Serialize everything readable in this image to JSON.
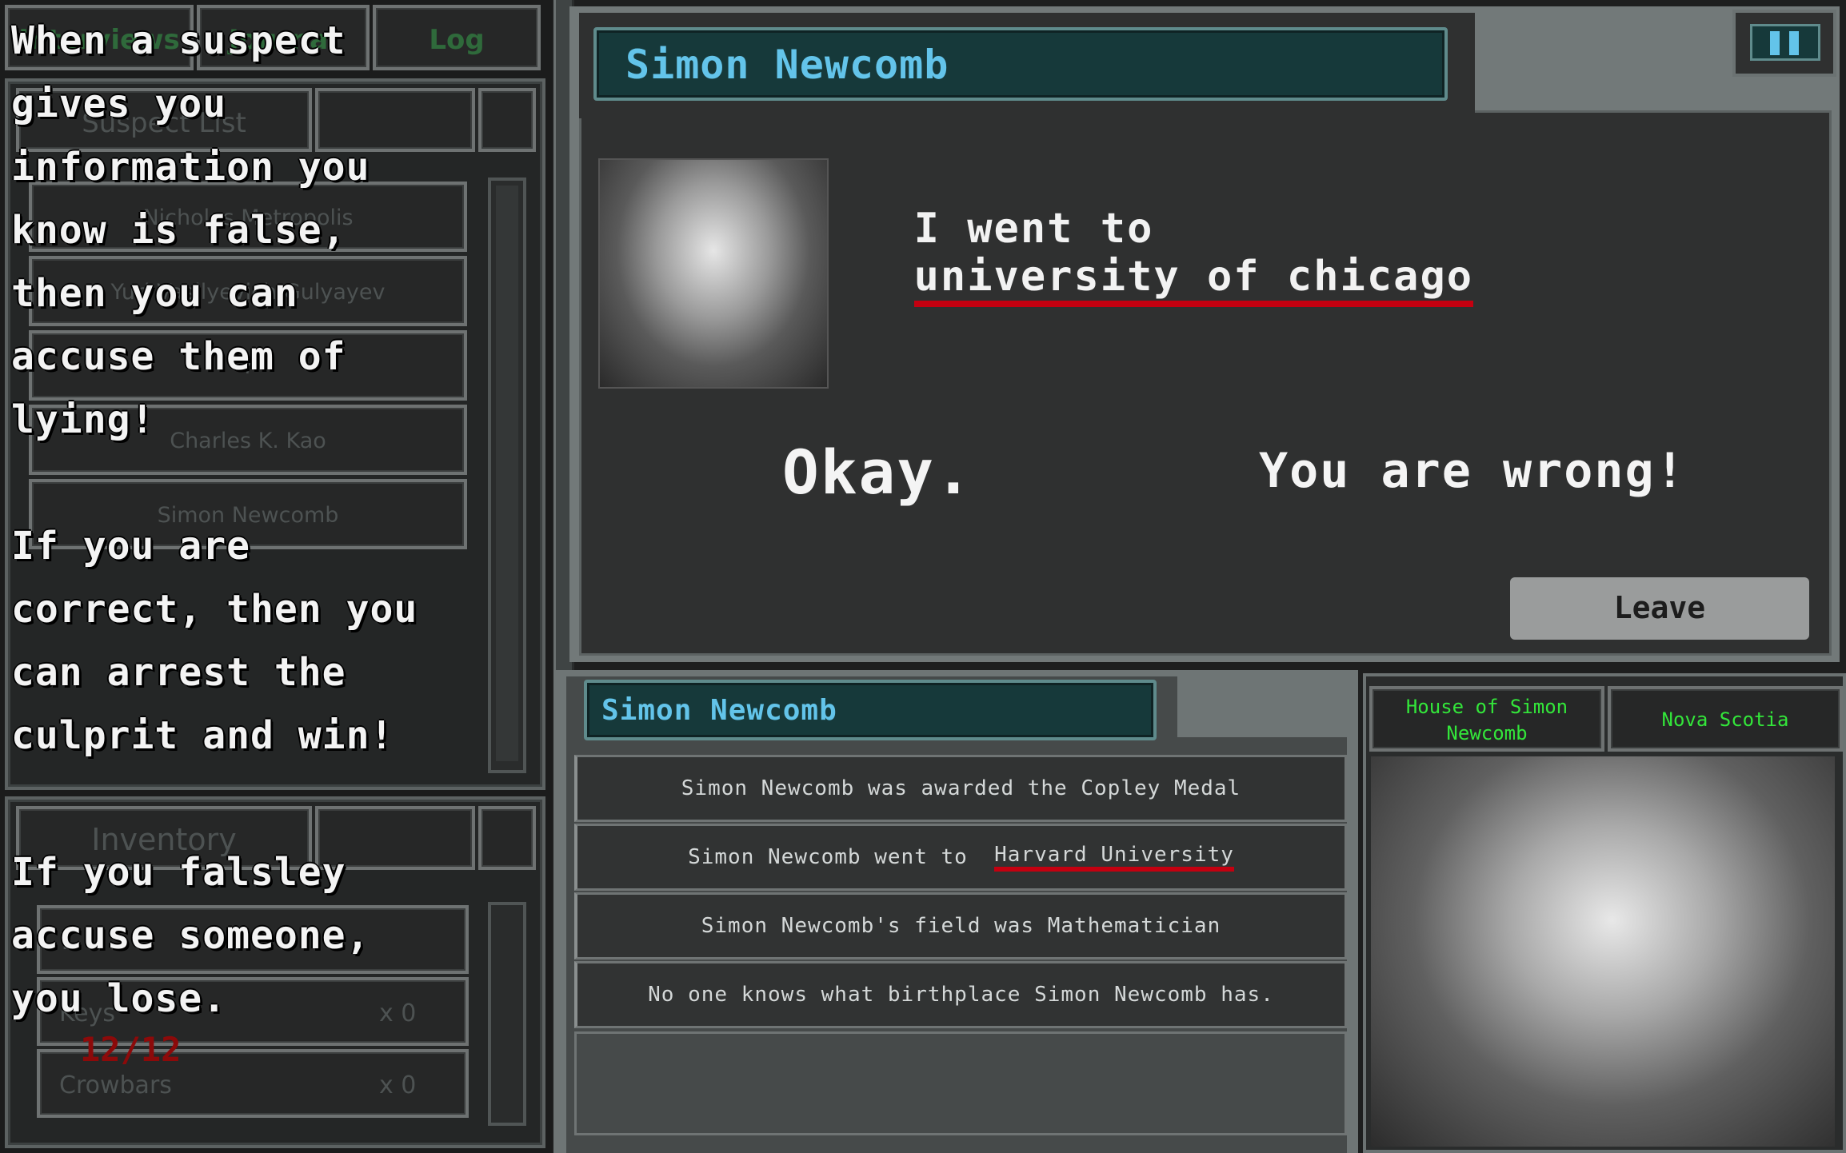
{
  "left_panel": {
    "tabs": [
      "Interviews",
      "Journal",
      "Log"
    ],
    "suspect_list_title": "Suspect List",
    "suspects": [
      "Nicholas Metropolis",
      "Yuri Vasilyevich Gulyayev",
      "?",
      "Charles K. Kao",
      "Simon Newcomb"
    ],
    "inventory_title": "Inventory",
    "inventory_items": [
      {
        "name": "?",
        "count": ""
      },
      {
        "name": "Keys",
        "count": "x 0"
      },
      {
        "name": "Crowbars",
        "count": "x 0"
      }
    ],
    "counter": "12/12"
  },
  "tutorial": {
    "para1": [
      "When a suspect",
      "gives you",
      "information you",
      "know is false,",
      "then you can",
      "accuse them of",
      "lying!"
    ],
    "para2": [
      "If you are",
      "correct, then you",
      "can arrest the",
      "culprit and win!"
    ],
    "para3": [
      "If you falsley",
      "accuse someone,",
      "you lose."
    ]
  },
  "dialogue": {
    "speaker": "Simon Newcomb",
    "statement_prefix": "I went to",
    "statement_highlight": "university of chicago",
    "option_ok": "Okay.",
    "option_wrong": "You are wrong!",
    "leave_label": "Leave",
    "pause_icon": "pause-icon"
  },
  "profile": {
    "name": "Simon Newcomb",
    "clues": [
      {
        "text": "Simon Newcomb was awarded the Copley Medal",
        "highlight": ""
      },
      {
        "prefix": "Simon Newcomb went to",
        "highlight": "Harvard University"
      },
      {
        "text": "Simon Newcomb's field was Mathematician",
        "highlight": ""
      },
      {
        "text": "No one knows what birthplace Simon Newcomb has.",
        "highlight": ""
      }
    ],
    "location": "House of Simon Newcomb",
    "region": "Nova Scotia"
  },
  "colors": {
    "accent_cyan": "#63c4ea",
    "teal": "#16393a",
    "highlight_red": "#c40010",
    "region_green": "#33e63a",
    "counter_red": "#8c0a0a"
  }
}
